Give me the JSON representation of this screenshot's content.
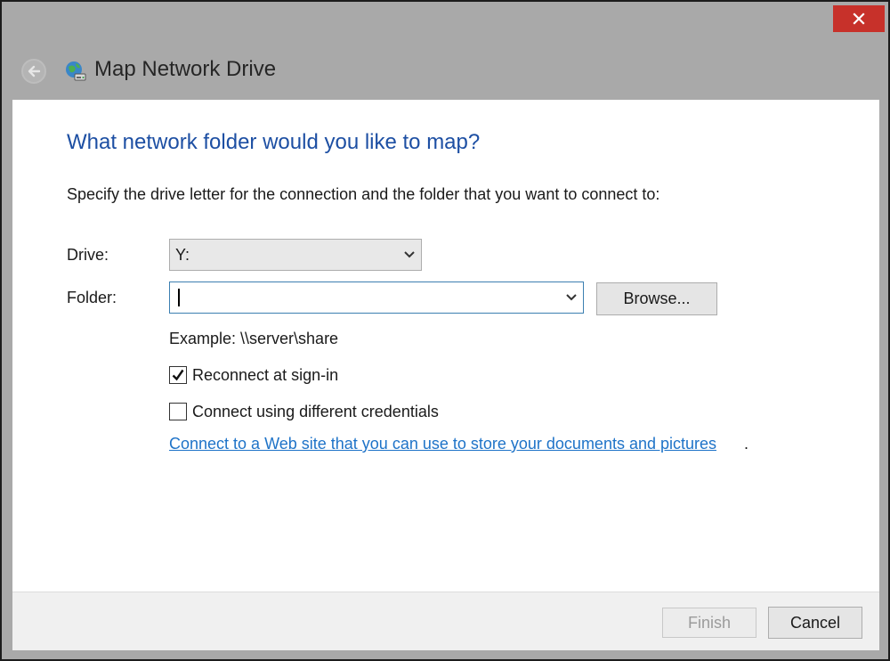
{
  "window": {
    "title": "Map Network Drive",
    "icons": {
      "close": "close-icon",
      "back": "back-arrow-icon",
      "app": "network-drive-icon"
    }
  },
  "main": {
    "heading": "What network folder would you like to map?",
    "instruction": "Specify the drive letter for the connection and the folder that you want to connect to:",
    "drive": {
      "label": "Drive:",
      "selected": "Y:"
    },
    "folder": {
      "label": "Folder:",
      "value": ""
    },
    "browse_label": "Browse...",
    "example": "Example: \\\\server\\share",
    "reconnect": {
      "label": "Reconnect at sign-in",
      "checked": true
    },
    "credentials": {
      "label": "Connect using different credentials",
      "checked": false
    },
    "web_link": "Connect to a Web site that you can use to store your documents and pictures",
    "web_link_suffix": "."
  },
  "footer": {
    "finish_label": "Finish",
    "cancel_label": "Cancel"
  },
  "colors": {
    "heading": "#1d4fa3",
    "link": "#1e73c8",
    "close_button": "#c7312a",
    "title_bar": "#a9a9a9"
  }
}
